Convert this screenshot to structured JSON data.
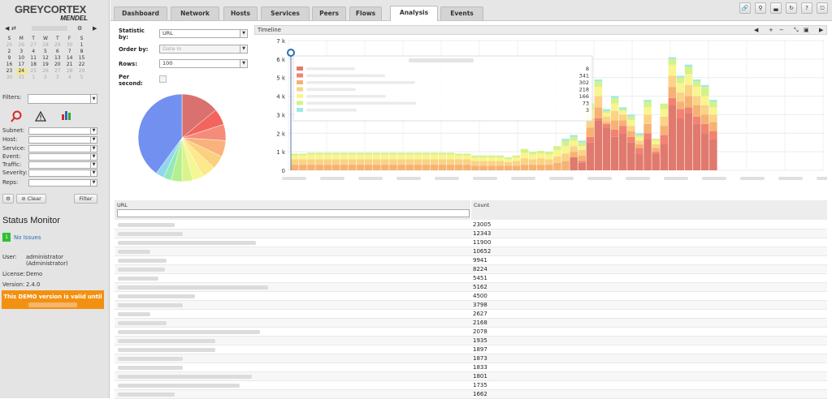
{
  "brand": {
    "line1": "GREYCORTEX",
    "line2": "MENDEL"
  },
  "calendar": {
    "weekdays": [
      "S",
      "M",
      "T",
      "W",
      "T",
      "F",
      "S"
    ],
    "weeks": [
      [
        {
          "d": "25",
          "o": true
        },
        {
          "d": "26",
          "o": true
        },
        {
          "d": "27",
          "o": true
        },
        {
          "d": "28",
          "o": true
        },
        {
          "d": "29",
          "o": true
        },
        {
          "d": "30",
          "o": true
        },
        {
          "d": "1"
        }
      ],
      [
        {
          "d": "2"
        },
        {
          "d": "3"
        },
        {
          "d": "4"
        },
        {
          "d": "5"
        },
        {
          "d": "6"
        },
        {
          "d": "7"
        },
        {
          "d": "8"
        }
      ],
      [
        {
          "d": "9"
        },
        {
          "d": "10"
        },
        {
          "d": "11"
        },
        {
          "d": "12"
        },
        {
          "d": "13"
        },
        {
          "d": "14"
        },
        {
          "d": "15"
        }
      ],
      [
        {
          "d": "16"
        },
        {
          "d": "17"
        },
        {
          "d": "18"
        },
        {
          "d": "19"
        },
        {
          "d": "20"
        },
        {
          "d": "21"
        },
        {
          "d": "22"
        }
      ],
      [
        {
          "d": "23"
        },
        {
          "d": "24",
          "t": true
        },
        {
          "d": "25",
          "o": true
        },
        {
          "d": "26",
          "o": true
        },
        {
          "d": "27",
          "o": true
        },
        {
          "d": "28",
          "o": true
        },
        {
          "d": "29",
          "o": true
        }
      ],
      [
        {
          "d": "30",
          "o": true
        },
        {
          "d": "31",
          "o": true
        },
        {
          "d": "1",
          "o": true
        },
        {
          "d": "2",
          "o": true
        },
        {
          "d": "3",
          "o": true
        },
        {
          "d": "4",
          "o": true
        },
        {
          "d": "5",
          "o": true
        }
      ]
    ]
  },
  "filters": {
    "label": "Filters:",
    "fields": [
      "Subnet:",
      "Host:",
      "Service:",
      "Event:",
      "Traffic:",
      "Severity:",
      "Reps:"
    ],
    "clear_label": "Clear",
    "filter_label": "Filter"
  },
  "status": {
    "title": "Status Monitor",
    "issue_count": "1",
    "issues": "No Issues",
    "user_label": "User:",
    "user_value": "administrator",
    "user_role": "(Administrator)",
    "license_label": "License:",
    "license_value": "Demo",
    "version_label": "Version:",
    "version_value": "2.4.0",
    "demo_text": "This DEMO version is valid until"
  },
  "tabs": [
    "Dashboard",
    "Network",
    "Hosts",
    "Services",
    "Peers",
    "Flows",
    "Analysis",
    "Events"
  ],
  "toolbar_icons": [
    "link-icon",
    "pin-icon",
    "stats-icon",
    "refresh-icon",
    "help-icon",
    "logout-icon"
  ],
  "form": {
    "statistic_label": "Statistic by:",
    "statistic_value": "URL",
    "order_label": "Order by:",
    "order_value": "Date In",
    "rows_label": "Rows:",
    "rows_value": "100",
    "per_second_label": "Per second:"
  },
  "timeline": {
    "title": "Timeline",
    "controls": [
      "◀",
      "+",
      "−",
      "⤡",
      "▣",
      "▶"
    ]
  },
  "legend_values": [
    "8",
    "341",
    "302",
    "218",
    "166",
    "73",
    "3"
  ],
  "colors": {
    "accent": "#f29111",
    "ok": "#2fc12f",
    "link": "#2a6db3"
  },
  "chart_data": [
    {
      "type": "pie",
      "values": [
        0.14,
        0.06,
        0.06,
        0.06,
        0.05,
        0.05,
        0.04,
        0.04,
        0.04,
        0.03,
        0.03,
        0.4
      ],
      "colors": [
        "#d9716e",
        "#f3645e",
        "#f58c7a",
        "#f9b27b",
        "#fbd07f",
        "#fde98b",
        "#f4f792",
        "#daf48c",
        "#b5ef8f",
        "#95e9b8",
        "#8fd6ef",
        "#7190f0"
      ]
    },
    {
      "type": "bar",
      "stacked": true,
      "ylim": [
        0,
        7000
      ],
      "yticks": [
        "0",
        "1 k",
        "2 k",
        "3 k",
        "4 k",
        "5 k",
        "6 k",
        "7 k"
      ],
      "series_colors": [
        "#e07a6e",
        "#f28272",
        "#f6b272",
        "#fbd286",
        "#f8f58e",
        "#d5f18a",
        "#9ee9e6"
      ],
      "bars": [
        [
          0,
          0,
          300,
          300,
          200,
          100,
          0
        ],
        [
          0,
          0,
          300,
          300,
          200,
          100,
          0
        ],
        [
          0,
          0,
          300,
          300,
          250,
          100,
          0
        ],
        [
          0,
          0,
          300,
          300,
          250,
          100,
          0
        ],
        [
          0,
          0,
          300,
          300,
          250,
          100,
          0
        ],
        [
          0,
          0,
          300,
          300,
          250,
          100,
          0
        ],
        [
          0,
          0,
          300,
          300,
          250,
          100,
          0
        ],
        [
          0,
          0,
          300,
          300,
          250,
          100,
          0
        ],
        [
          0,
          0,
          300,
          300,
          250,
          100,
          0
        ],
        [
          0,
          0,
          300,
          300,
          250,
          100,
          0
        ],
        [
          0,
          0,
          300,
          300,
          250,
          100,
          0
        ],
        [
          0,
          0,
          300,
          300,
          250,
          100,
          0
        ],
        [
          0,
          0,
          300,
          300,
          250,
          100,
          0
        ],
        [
          0,
          0,
          300,
          300,
          250,
          100,
          0
        ],
        [
          0,
          0,
          300,
          300,
          250,
          100,
          0
        ],
        [
          0,
          0,
          300,
          300,
          250,
          100,
          0
        ],
        [
          0,
          0,
          300,
          300,
          250,
          100,
          0
        ],
        [
          0,
          0,
          300,
          300,
          250,
          100,
          0
        ],
        [
          0,
          0,
          300,
          300,
          250,
          100,
          0
        ],
        [
          0,
          0,
          300,
          300,
          250,
          100,
          0
        ],
        [
          0,
          0,
          300,
          300,
          200,
          100,
          0
        ],
        [
          0,
          0,
          300,
          300,
          200,
          100,
          0
        ],
        [
          0,
          0,
          250,
          250,
          200,
          100,
          0
        ],
        [
          0,
          0,
          250,
          250,
          200,
          100,
          0
        ],
        [
          0,
          0,
          250,
          250,
          200,
          100,
          0
        ],
        [
          0,
          0,
          250,
          250,
          200,
          100,
          0
        ],
        [
          0,
          0,
          250,
          200,
          150,
          100,
          0
        ],
        [
          0,
          0,
          250,
          250,
          200,
          100,
          0
        ],
        [
          0,
          0,
          300,
          350,
          300,
          200,
          0
        ],
        [
          0,
          0,
          300,
          300,
          250,
          150,
          0
        ],
        [
          0,
          0,
          300,
          350,
          250,
          150,
          0
        ],
        [
          0,
          0,
          300,
          300,
          250,
          150,
          0
        ],
        [
          0,
          0,
          400,
          350,
          350,
          200,
          0
        ],
        [
          0,
          0,
          500,
          400,
          400,
          300,
          100
        ],
        [
          700,
          0,
          300,
          300,
          300,
          200,
          100
        ],
        [
          400,
          100,
          300,
          300,
          200,
          200,
          100
        ],
        [
          1500,
          300,
          500,
          500,
          500,
          300,
          0
        ],
        [
          2700,
          100,
          600,
          600,
          500,
          300,
          100
        ],
        [
          2300,
          200,
          100,
          300,
          200,
          100,
          100
        ],
        [
          1800,
          400,
          500,
          500,
          400,
          300,
          100
        ],
        [
          2000,
          400,
          300,
          300,
          200,
          100,
          100
        ],
        [
          1500,
          300,
          300,
          300,
          300,
          200,
          100
        ],
        [
          900,
          300,
          200,
          200,
          200,
          100,
          100
        ],
        [
          1700,
          300,
          500,
          500,
          400,
          300,
          100
        ],
        [
          900,
          100,
          200,
          200,
          200,
          100,
          0
        ],
        [
          1400,
          500,
          500,
          500,
          400,
          300,
          0
        ],
        [
          3500,
          400,
          600,
          600,
          600,
          300,
          100
        ],
        [
          2800,
          500,
          400,
          500,
          500,
          300,
          100
        ],
        [
          3100,
          300,
          600,
          600,
          600,
          400,
          100
        ],
        [
          2500,
          400,
          600,
          500,
          500,
          300,
          100
        ],
        [
          2000,
          500,
          500,
          500,
          500,
          500,
          100
        ],
        [
          1700,
          400,
          500,
          400,
          400,
          300,
          100
        ]
      ]
    },
    {
      "type": "table",
      "columns": [
        "URL",
        "Count"
      ],
      "rows": [
        "23005",
        "12343",
        "11900",
        "10652",
        "9941",
        "8224",
        "5451",
        "5162",
        "4500",
        "3798",
        "2627",
        "2168",
        "2078",
        "1935",
        "1897",
        "1873",
        "1833",
        "1801",
        "1735",
        "1662"
      ]
    }
  ]
}
